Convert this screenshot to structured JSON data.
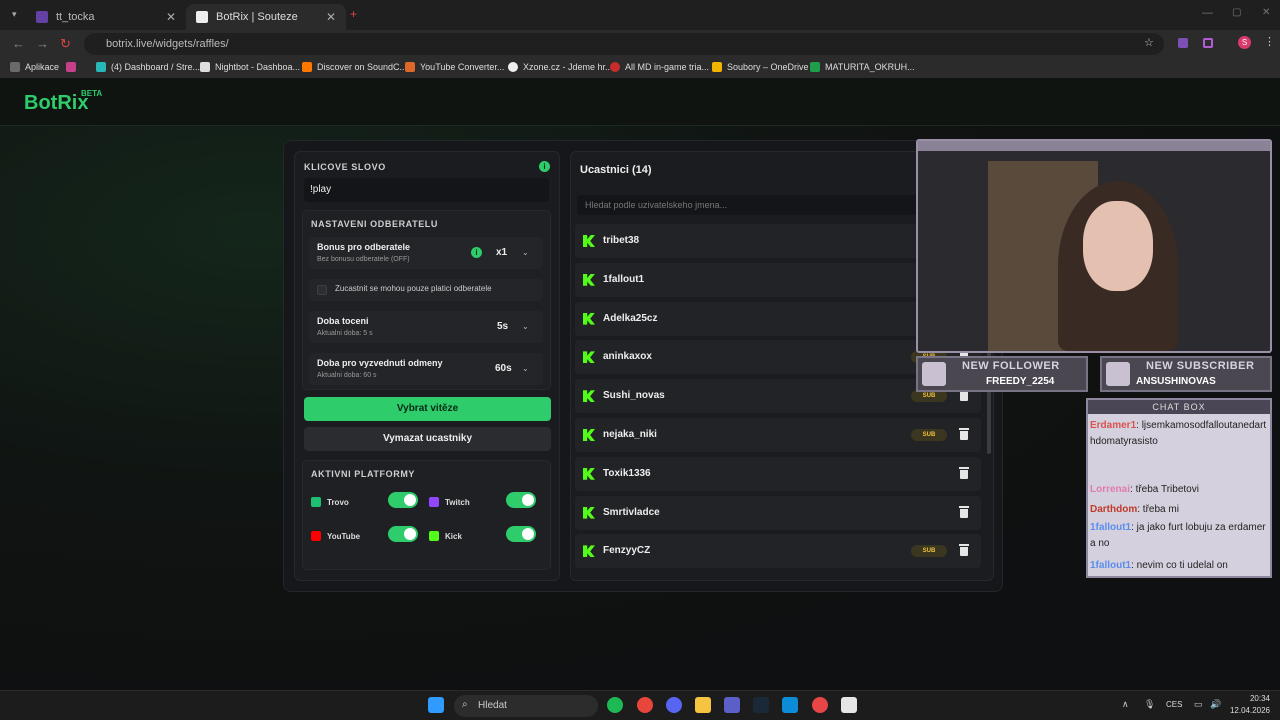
{
  "browser": {
    "tabs": [
      {
        "title": "tt_tocka"
      },
      {
        "title": "BotRix | Souteze"
      }
    ],
    "url": "botrix.live/widgets/raffles/",
    "bookmarks": [
      "Aplikace",
      "(4) Dashboard / Stre...",
      "Nightbot - Dashboa...",
      "Discover on SoundC...",
      "YouTube Converter...",
      "Xzone.cz - Jdeme hr...",
      "All MD in-game tria...",
      "Soubory – OneDrive",
      "MATURITA_OKRUH..."
    ]
  },
  "app": {
    "logo": "BotRix",
    "logo_badge": "BETA"
  },
  "settings": {
    "keyword_label": "KLICOVE SLOVO",
    "keyword_value": "!play",
    "subscriber_section": "NASTAVENI ODBERATELU",
    "bonus_title": "Bonus pro odberatele",
    "bonus_sub": "Bez bonusu odberatele (OFF)",
    "bonus_value": "x1",
    "subs_only_label": "Zucastnit se mohou pouze platici odberatele",
    "spin_title": "Doba toceni",
    "spin_sub": "Aktualni doba: 5 s",
    "spin_value": "5s",
    "claim_title": "Doba pro vyzvednuti odmeny",
    "claim_sub": "Aktualni doba: 60 s",
    "claim_value": "60s",
    "pick_winner_label": "Vybrat vitěze",
    "clear_label": "Vymazat ucastniky",
    "platforms_label": "AKTIVNI PLATFORMY",
    "platforms": [
      {
        "name": "Trovo",
        "enabled": true,
        "color": "#1dbf73"
      },
      {
        "name": "Twitch",
        "enabled": true,
        "color": "#9146ff"
      },
      {
        "name": "YouTube",
        "enabled": true,
        "color": "#ff0000"
      },
      {
        "name": "Kick",
        "enabled": true,
        "color": "#53fc18"
      }
    ]
  },
  "participants": {
    "title": "Ucastnici (14)",
    "search_placeholder": "Hledat podle uzivatelskeho jmena...",
    "sub_badge": "SUB",
    "list": [
      {
        "name": "tribet38",
        "sub": false
      },
      {
        "name": "1fallout1",
        "sub": false
      },
      {
        "name": "Adelka25cz",
        "sub": false
      },
      {
        "name": "aninkaxox",
        "sub": true
      },
      {
        "name": "Sushi_novas",
        "sub": true
      },
      {
        "name": "nejaka_niki",
        "sub": true
      },
      {
        "name": "Toxik1336",
        "sub": false
      },
      {
        "name": "Smrtivladce",
        "sub": false
      },
      {
        "name": "FenzyyCZ",
        "sub": true
      }
    ]
  },
  "overlay": {
    "new_follower_title": "NEW FOLLOWER",
    "new_follower_name": "FREEDY_2254",
    "new_sub_title": "NEW SUBSCRIBER",
    "new_sub_name": "ANSUSHINOVAS",
    "chat_title": "CHAT BOX",
    "chat": [
      {
        "user": "Erdamer1",
        "text": ": ljsemkamosodfalloutanedarthdomatyrasisto",
        "color": "#d9534f"
      },
      {
        "user": "Lorrenai",
        "text": ": třeba Tribetovi",
        "color": "#e07bb0"
      },
      {
        "user": "Darthdom",
        "text": ": třeba mi",
        "color": "#c0392b"
      },
      {
        "user": "1fallout1",
        "text": ": ja jako furt lobuju za erdamera no",
        "color": "#5b8def"
      },
      {
        "user": "1fallout1",
        "text": ": nevim co ti udelal on",
        "color": "#5b8def"
      }
    ]
  },
  "taskbar": {
    "search": "Hledat",
    "lang": "CES",
    "time": "20:34",
    "date": "12.04.2026"
  }
}
